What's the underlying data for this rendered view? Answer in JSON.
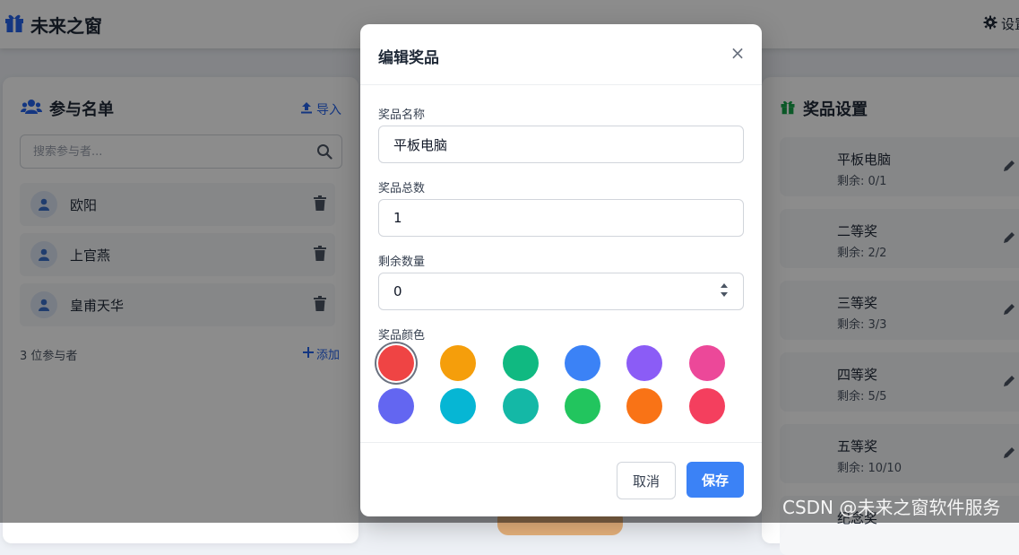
{
  "app": {
    "title": "未来之窗",
    "settings_label": "设置"
  },
  "participants": {
    "title": "参与名单",
    "import_label": "导入",
    "search_placeholder": "搜索参与者...",
    "items": [
      {
        "name": "欧阳"
      },
      {
        "name": "上官燕"
      },
      {
        "name": "皇甫天华"
      }
    ],
    "count_text": "3 位参与者",
    "add_label": "添加"
  },
  "prizes": {
    "title": "奖品设置",
    "items": [
      {
        "name": "平板电脑",
        "remain": "剩余: 0/1"
      },
      {
        "name": "二等奖",
        "remain": "剩余: 2/2"
      },
      {
        "name": "三等奖",
        "remain": "剩余: 3/3"
      },
      {
        "name": "四等奖",
        "remain": "剩余: 5/5"
      },
      {
        "name": "五等奖",
        "remain": "剩余: 10/10"
      },
      {
        "name": "纪念奖",
        "remain": ""
      }
    ]
  },
  "modal": {
    "title": "编辑奖品",
    "close_glyph": "×",
    "name_label": "奖品名称",
    "name_value": "平板电脑",
    "total_label": "奖品总数",
    "total_value": "1",
    "remain_label": "剩余数量",
    "remain_value": "0",
    "color_label": "奖品颜色",
    "colors": [
      "#ef4444",
      "#f59e0b",
      "#10b981",
      "#3b82f6",
      "#8b5cf6",
      "#ec4899",
      "#6366f1",
      "#06b6d4",
      "#14b8a6",
      "#22c55e",
      "#f97316",
      "#f43f5e"
    ],
    "selected_color": "#ef4444",
    "cancel_label": "取消",
    "save_label": "保存"
  },
  "watermark": "CSDN @未来之窗软件服务"
}
